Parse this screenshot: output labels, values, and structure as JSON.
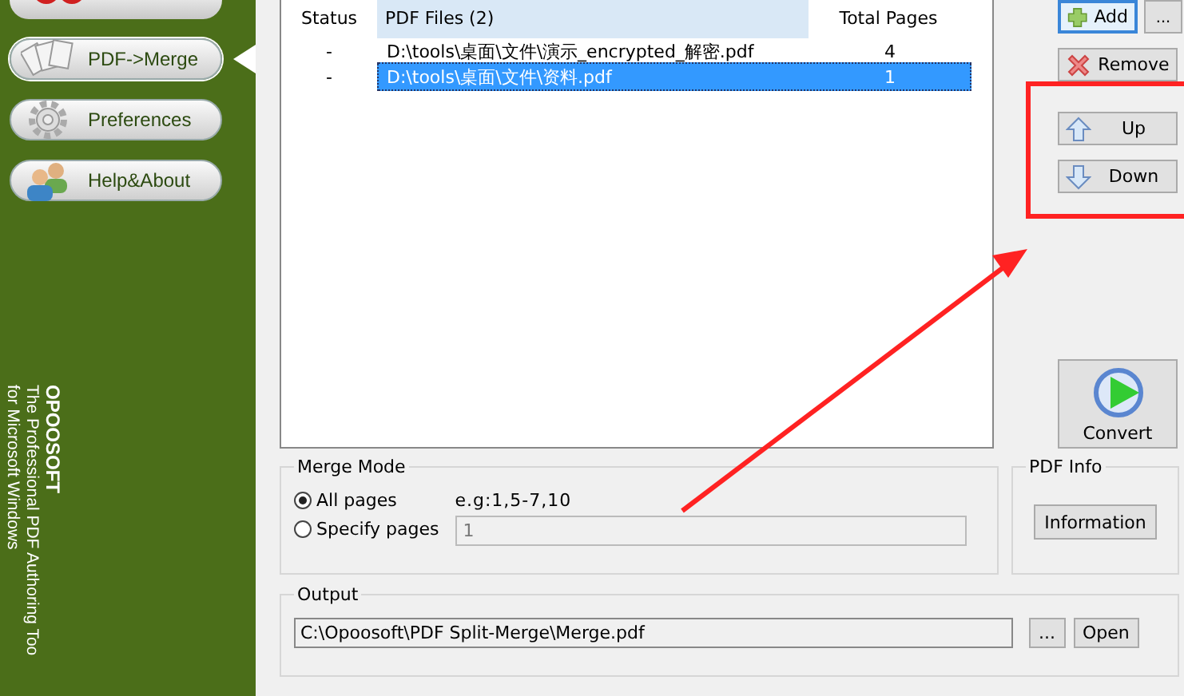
{
  "sidebar": {
    "items": [
      {
        "label": "PDF->Merge",
        "kind": "pages",
        "selected": true
      },
      {
        "label": "Preferences",
        "kind": "gear",
        "selected": false
      },
      {
        "label": "Help&About",
        "kind": "people",
        "selected": false
      }
    ],
    "brand": {
      "name": "OPOOSOFT",
      "tagline": [
        "The Professional PDF Authoring Too",
        "for Microsoft Windows"
      ]
    }
  },
  "table": {
    "columns": [
      "Status",
      "PDF Files (2)",
      "Total Pages"
    ],
    "rows": [
      {
        "status": "-",
        "file": "D:\\tools\\桌面\\文件\\演示_encrypted_解密.pdf",
        "pages": "4",
        "selected": false
      },
      {
        "status": "-",
        "file": "D:\\tools\\桌面\\文件\\资料.pdf",
        "pages": "1",
        "selected": true
      }
    ]
  },
  "side_buttons": [
    {
      "label": "Add",
      "kind": "add"
    },
    {
      "label": "Remove",
      "kind": "remove"
    },
    {
      "label": "Up",
      "kind": "up"
    },
    {
      "label": "Down",
      "kind": "down"
    }
  ],
  "more_button": "...",
  "convert_button": "Convert",
  "merge_mode": {
    "title": "Merge Mode",
    "options": [
      {
        "label": "All pages",
        "selected": true
      },
      {
        "label": "Specify pages",
        "selected": false
      }
    ],
    "hint": "e.g:1,5-7,10",
    "pages_field": {
      "value": "1",
      "disabled": true
    }
  },
  "pdf_info": {
    "title": "PDF Info",
    "button": "Information"
  },
  "output": {
    "title": "Output",
    "path": "C:\\Opoosoft\\PDF Split-Merge\\Merge.pdf",
    "browse_button": "...",
    "open_button": "Open"
  }
}
